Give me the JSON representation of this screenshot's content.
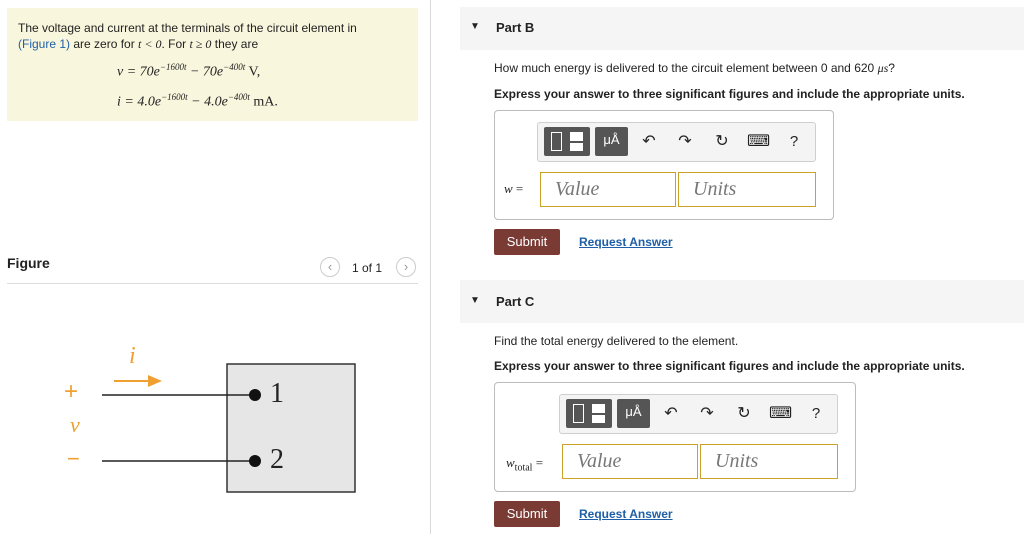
{
  "problem": {
    "line1": "The voltage and current at the terminals of the circuit element in",
    "figure_link": "(Figure 1)",
    "line2a": " are zero for ",
    "cond1": "t < 0",
    "line2b": ". For ",
    "cond2": "t ≥ 0",
    "line2c": " they are",
    "eq_v": {
      "lhs": "v = 70e",
      "exp1": "−1600t",
      "mid": " − 70e",
      "exp2": "−400t",
      "unit": " V,"
    },
    "eq_i": {
      "lhs": "i = 4.0e",
      "exp1": "−1600t",
      "mid": " − 4.0e",
      "exp2": "−400t",
      "unit": " mA."
    }
  },
  "figure": {
    "title": "Figure",
    "page_indicator": "1 of 1",
    "prev_icon": "‹",
    "next_icon": "›",
    "current_label": "i",
    "plus_label": "+",
    "voltage_label": "v",
    "minus_label": "−",
    "terminal1": "1",
    "terminal2": "2"
  },
  "partB": {
    "title": "Part B",
    "question_a": "How much energy is delivered to the circuit element between 0 and 620 ",
    "question_unit": "μs",
    "question_b": "?",
    "instruction": "Express your answer to three significant figures and include the appropriate units.",
    "var_label": "w",
    "value_placeholder": "Value",
    "units_placeholder": "Units",
    "submit": "Submit",
    "request": "Request Answer"
  },
  "partC": {
    "title": "Part C",
    "question": "Find the total energy delivered to the element.",
    "instruction": "Express your answer to three significant figures and include the appropriate units.",
    "var_label": "w",
    "var_sub": "total",
    "value_placeholder": "Value",
    "units_placeholder": "Units",
    "submit": "Submit",
    "request": "Request Answer"
  },
  "toolbar": {
    "mu_label": "μÅ",
    "undo_icon": "↶",
    "redo_icon": "↷",
    "reset_icon": "↻",
    "keyboard_icon": "⌨",
    "help_label": "?"
  },
  "colors": {
    "problem_bg": "#f8f6dc",
    "submit_bg": "#7b3b35",
    "link": "#1f5fa8",
    "field_border": "#c9a227",
    "arrow": "#f0a030"
  }
}
